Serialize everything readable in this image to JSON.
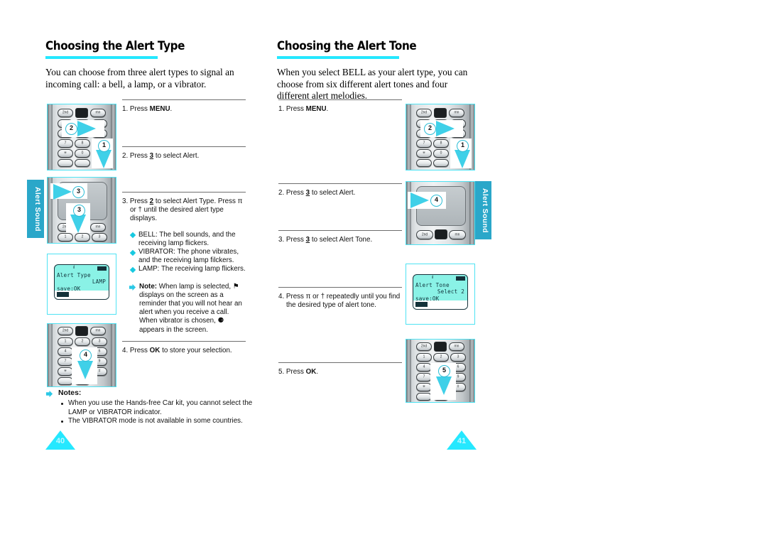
{
  "document": {
    "type": "mobile-phone-user-manual-spread",
    "accent_cyan": "#25e8ff",
    "tab_color": "#2aa7c9"
  },
  "left_page": {
    "page_number": "40",
    "side_tab": "Alert Sound",
    "title": "Choosing the Alert Type",
    "intro": "You can choose from three alert types to signal an incoming call: a bell, a lamp, or a vibrator.",
    "steps": [
      {
        "number": "1.",
        "text_parts": {
          "pre": "Press ",
          "bold": "MENU",
          "post": "."
        }
      },
      {
        "number": "2.",
        "text_parts": {
          "pre": "Press ",
          "bold": "3",
          "post": " to select Alert."
        }
      },
      {
        "number": "3.",
        "text_parts": {
          "pre": "Press ",
          "bold": "2",
          "post": " to select Alert Type. Press π or † until the desired alert type displays."
        }
      },
      {
        "number": "4.",
        "text_parts": {
          "pre": "Press ",
          "bold": "OK",
          "post": " to store your selection."
        }
      }
    ],
    "alert_types": [
      "BELL: The bell sounds, and the receiving lamp flickers.",
      "VIBRATOR: The phone vibrates, and the receiving lamp filckers.",
      "LAMP: The receiving lamp flickers."
    ],
    "note": {
      "label": "Note:",
      "text": "When lamp is selected, ⚑ displays on the screen as a reminder that you will not hear an alert when you receive a call. When vibrator is chosen, ⚈ appears in the screen."
    },
    "notes_block": {
      "heading": "Notes:",
      "items": [
        "When you use the Hands-free Car kit, you cannot select the LAMP or VIBRATOR indicator.",
        "The VIBRATOR mode is not available in some countries."
      ]
    },
    "figures": [
      {
        "name": "keypad-press-2-then-1",
        "callout_numbers": [
          "2",
          "1"
        ]
      },
      {
        "name": "navigation-key-press-3",
        "callout_numbers": [
          "3",
          "3"
        ]
      },
      {
        "name": "lcd-alert-type-lamp"
      },
      {
        "name": "keypad-press-4",
        "callout_numbers": [
          "4"
        ]
      }
    ],
    "lcd": {
      "line1": "Alert Type",
      "line2": "LAMP",
      "line3": "save:OK"
    }
  },
  "right_page": {
    "page_number": "41",
    "side_tab": "Alert Sound",
    "title": "Choosing the Alert Tone",
    "intro": "When you select BELL as your alert type, you can choose from six different alert tones and four different alert melodies.",
    "steps": [
      {
        "number": "1.",
        "text_parts": {
          "pre": "Press ",
          "bold": "MENU",
          "post": "."
        }
      },
      {
        "number": "2.",
        "text_parts": {
          "pre": "Press ",
          "bold": "3",
          "post": " to select Alert."
        }
      },
      {
        "number": "3.",
        "text_parts": {
          "pre": "Press ",
          "bold": "3",
          "post": " to select Alert Tone."
        }
      },
      {
        "number": "4.",
        "text_parts": {
          "pre": "Press π or † repeatedly until you find the desired type of alert tone.",
          "bold": "",
          "post": ""
        }
      },
      {
        "number": "5.",
        "text_parts": {
          "pre": "Press ",
          "bold": "OK",
          "post": "."
        }
      }
    ],
    "figures": [
      {
        "name": "keypad-press-2-then-1",
        "callout_numbers": [
          "2",
          "1"
        ]
      },
      {
        "name": "navigation-key-press-4",
        "callout_numbers": [
          "4"
        ]
      },
      {
        "name": "lcd-alert-tone-select-2"
      },
      {
        "name": "keypad-press-5",
        "callout_numbers": [
          "5"
        ]
      }
    ],
    "lcd": {
      "line1": "Alert Tone",
      "line2": "Select 2",
      "line3": "save:OK"
    }
  },
  "keypad_labels": {
    "row_soft": [
      "2nd",
      "",
      "mn"
    ],
    "rows": [
      [
        "1",
        "2 ABC",
        "3 DEF"
      ],
      [
        "4 GHI",
        "5 JKL",
        "6 MNO"
      ],
      [
        "7 PQRS",
        "8 TUV",
        "9 WXYZ"
      ],
      [
        "∗",
        "0",
        "#"
      ]
    ]
  }
}
